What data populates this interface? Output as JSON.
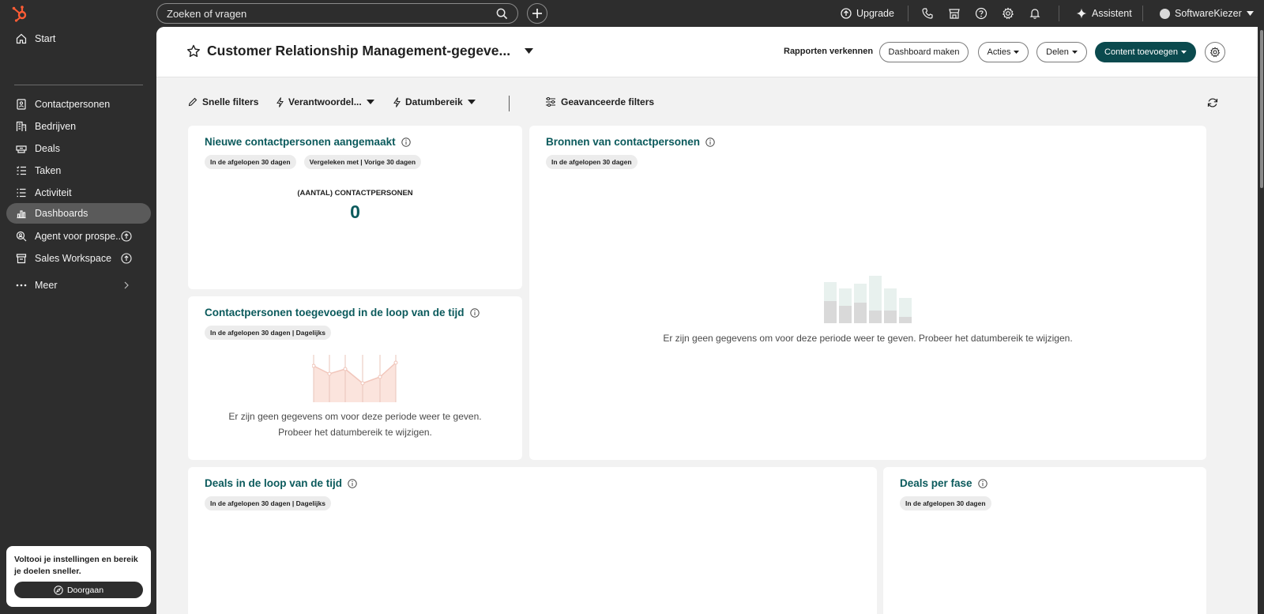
{
  "topbar": {
    "search_placeholder": "Zoeken of vragen",
    "upgrade": "Upgrade",
    "assistant": "Assistent",
    "account": "SoftwareKiezer"
  },
  "sidebar": {
    "items": [
      {
        "label": "Start",
        "icon": "home-icon"
      },
      {
        "label": "Contactpersonen",
        "icon": "contacts-icon"
      },
      {
        "label": "Bedrijven",
        "icon": "companies-icon"
      },
      {
        "label": "Deals",
        "icon": "deals-icon"
      },
      {
        "label": "Taken",
        "icon": "tasks-icon"
      },
      {
        "label": "Activiteit",
        "icon": "activity-icon"
      },
      {
        "label": "Dashboards",
        "icon": "dashboards-icon",
        "active": true
      },
      {
        "label": "Agent voor prospe...",
        "icon": "prospecting-icon"
      },
      {
        "label": "Sales Workspace",
        "icon": "workspace-icon"
      },
      {
        "label": "Meer",
        "icon": "more-icon"
      }
    ],
    "promo": {
      "text": "Voltooi je instellingen en bereik je doelen sneller.",
      "button": "Doorgaan"
    }
  },
  "header": {
    "title": "Customer Relationship Management-gegeve...",
    "explore_link": "Rapporten verkennen",
    "create_dashboard": "Dashboard maken",
    "actions": "Acties",
    "share": "Delen",
    "add_content": "Content toevoegen"
  },
  "filters": {
    "quick": "Snelle filters",
    "owner": "Verantwoordel...",
    "date_range": "Datumbereik",
    "advanced": "Geavanceerde filters"
  },
  "cards": {
    "new_contacts": {
      "title": "Nieuwe contactpersonen aangemaakt",
      "pill1": "In de afgelopen 30 dagen",
      "pill2": "Vergeleken met | Vorige 30 dagen",
      "kpi_label": "(AANTAL) CONTACTPERSONEN",
      "kpi_value": "0"
    },
    "contact_sources": {
      "title": "Bronnen van contactpersonen",
      "pill1": "In de afgelopen 30 dagen",
      "empty": "Er zijn geen gegevens om voor deze periode weer te geven. Probeer het datumbereik te wijzigen."
    },
    "contacts_over_time": {
      "title": "Contactpersonen toegevoegd in de loop van de tijd",
      "pill1": "In de afgelopen 30 dagen | Dagelijks",
      "empty_line1": "Er zijn geen gegevens om voor deze periode weer te geven.",
      "empty_line2": "Probeer het datumbereik te wijzigen."
    },
    "deals_over_time": {
      "title": "Deals in de loop van de tijd",
      "pill1": "In de afgelopen 30 dagen | Dagelijks"
    },
    "deals_per_stage": {
      "title": "Deals per fase",
      "pill1": "In de afgelopen 30 dagen"
    }
  },
  "colors": {
    "brand_teal": "#0b4a4e",
    "title_teal": "#0b5a5c",
    "logo_orange": "#ff5c35",
    "chart_pink": "#f8d9d0"
  }
}
